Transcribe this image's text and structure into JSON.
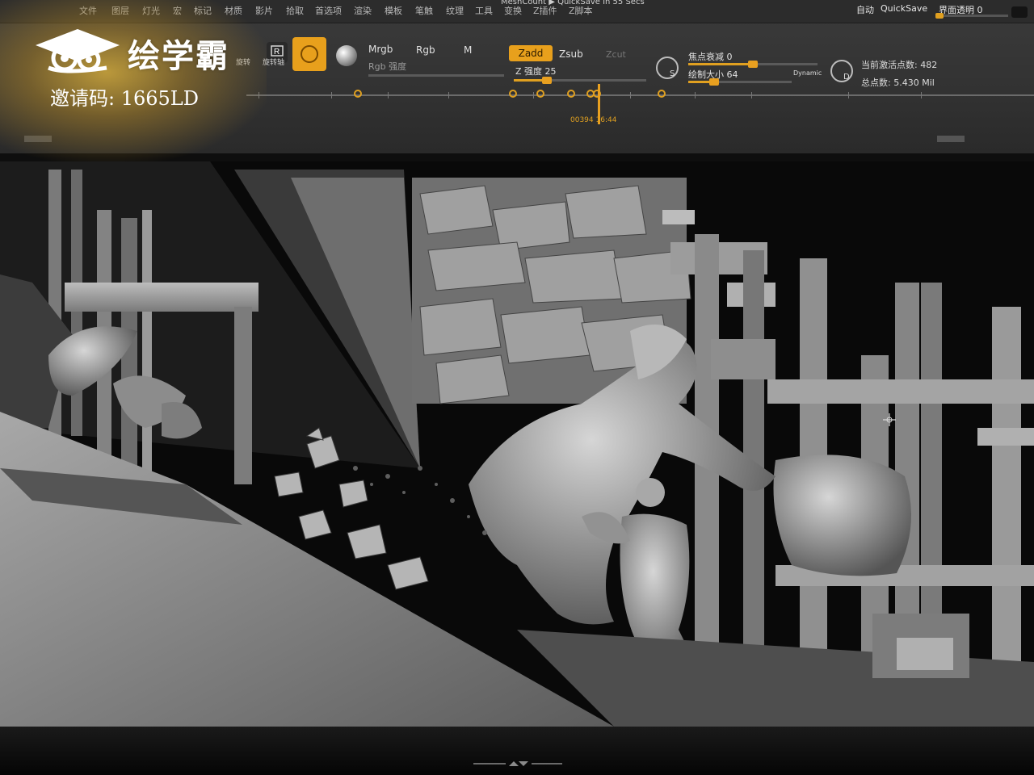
{
  "menu": {
    "items": [
      "文件",
      "图层",
      "灯光",
      "宏",
      "标记",
      "材质",
      "影片",
      "拾取",
      "首选项",
      "渲染",
      "模板",
      "笔触",
      "纹理",
      "工具",
      "变换",
      "Z插件",
      "Z脚本"
    ],
    "title_status": "MeshCount ▶ QuickSave In 55 Secs",
    "autosave_label": "自动",
    "quicksave_label": "QuickSave",
    "ui_transparency_label": "界面透明",
    "ui_transparency_value": "0",
    "ui_transparency_level": 0
  },
  "watermark": {
    "logo_text": "绘学霸",
    "invite_code": "邀请码: 1665LD"
  },
  "toolbar": {
    "prev_tool_label": "旋转",
    "r_tool_label": "旋转轴",
    "mrgb_label": "Mrgb",
    "rgb_label": "Rgb",
    "m_label": "M",
    "rgb_intensity_label": "Rgb 强度",
    "zadd_label": "Zadd",
    "zsub_label": "Zsub",
    "zcut_label": "Zcut",
    "z_intensity_label": "Z 强度",
    "z_intensity_value": "25",
    "z_intensity_level": 0.25,
    "focal_shift_label": "焦点衰减",
    "focal_shift_value": "0",
    "focal_shift_level": 0.5,
    "draw_size_label": "绘制大小",
    "draw_size_value": "64",
    "draw_size_level": 0.25,
    "dynamic_label": "Dynamic",
    "brush_s_letter": "S",
    "brush_d_letter": "D",
    "active_points_label": "当前激活点数:",
    "active_points_value": "482",
    "total_points_label": "总点数:",
    "total_points_value": "5.430 Mil"
  },
  "timeline": {
    "time_readout": "00394  16:44",
    "keyframe_count": 7
  },
  "colors": {
    "accent": "#e8a01c",
    "toolbar_bg": "#353535",
    "viewport_bg": "#090909",
    "model_gray": "#8e8e8e"
  },
  "icons": [
    "cloud-logo-icon",
    "rotate-tool-icon",
    "draw-brush-icon",
    "material-sphere-icon",
    "brush-s-icon",
    "brush-d-icon",
    "crosshair-cursor-icon",
    "close-icon"
  ]
}
